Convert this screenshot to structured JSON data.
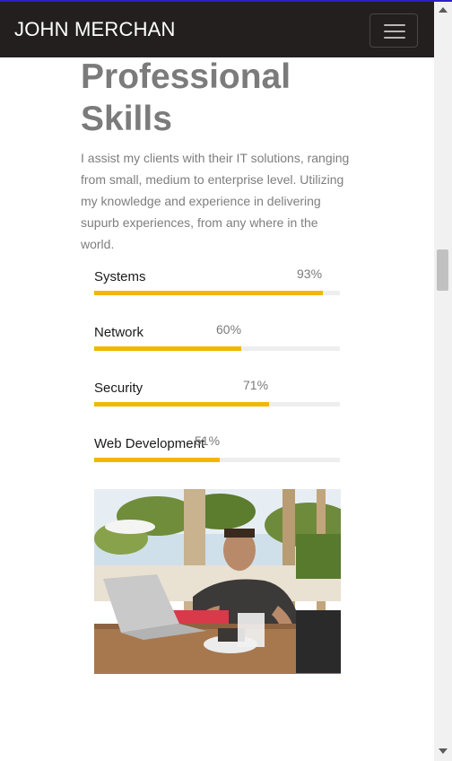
{
  "navbar": {
    "brand": "JOHN MERCHAN",
    "toggle_icon": "hamburger-menu-icon"
  },
  "section": {
    "heading_line1": "Professional",
    "heading_line2": "Skills",
    "intro": "I assist my clients with their IT solutions, ranging from small, medium to enterprise level. Utilizing my knowledge and experience in delivering supurb experiences, from any where in the world."
  },
  "skills": [
    {
      "name": "Systems",
      "percent_label": "93%",
      "progress": 0.93
    },
    {
      "name": "Network",
      "percent_label": "60%",
      "progress": 0.6
    },
    {
      "name": "Security",
      "percent_label": "71%",
      "progress": 0.71
    },
    {
      "name": "Web Development",
      "percent_label": "51%",
      "progress": 0.51
    }
  ],
  "colors": {
    "navbar_bg": "#231f1f",
    "progress_fill": "#f2b705",
    "progress_track": "#eeeeee",
    "heading": "#7b7b7b"
  }
}
